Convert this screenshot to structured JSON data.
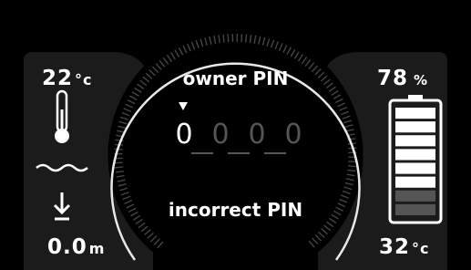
{
  "left": {
    "temperature_value": "22",
    "temperature_unit": "°c",
    "thermometer_icon": "thermometer-icon",
    "water_icon": "water-waves-icon",
    "depth_icon": "descend-arrow-icon",
    "depth_value": "0.0",
    "depth_unit": "m"
  },
  "center": {
    "title": "owner PIN",
    "cursor_icon": "selector-triangle-icon",
    "pin_digits": [
      "0",
      "0",
      "0",
      "0"
    ],
    "active_digit_index": 0,
    "status": "incorrect PIN"
  },
  "right": {
    "battery_value": "78",
    "battery_unit": "%",
    "battery_icon": "battery-icon",
    "battery_segments_total": 8,
    "battery_segments_white": 6,
    "battery_segments_gray": 2,
    "temperature_value": "32",
    "temperature_unit": "°c"
  },
  "colors": {
    "background": "#000000",
    "panel": "#1a1a1a",
    "accent": "#ffffff",
    "muted": "#555555"
  }
}
